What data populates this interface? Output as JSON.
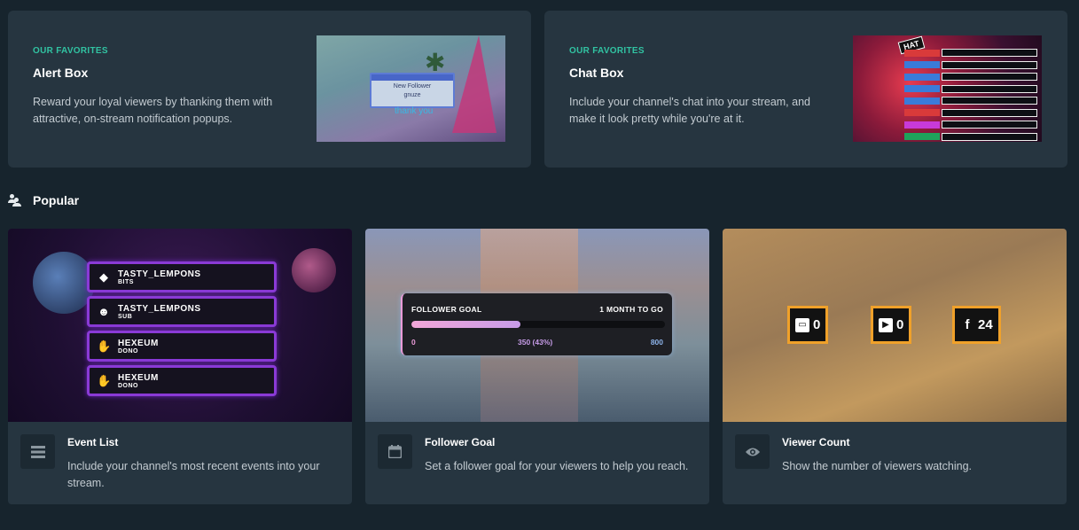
{
  "favorites": [
    {
      "eyebrow": "OUR FAVORITES",
      "title": "Alert Box",
      "description": "Reward your loyal viewers by thanking them with attractive, on-stream notification popups.",
      "preview": {
        "window_title": "New Follower",
        "window_text": "gnuze",
        "thanks_text": "thank you"
      }
    },
    {
      "eyebrow": "OUR FAVORITES",
      "title": "Chat Box",
      "description": "Include your channel's chat into your stream, and make it look pretty while you're at it.",
      "preview": {
        "logo_text": "HAT",
        "tag_colors": [
          "#d93a3a",
          "#3a7bd9",
          "#3a7bd9",
          "#3a7bd9",
          "#3a7bd9",
          "#d93a3a",
          "#c83ad9",
          "#1fa35b",
          "#1fa35b",
          "#d9a23a"
        ]
      }
    }
  ],
  "popular": {
    "heading": "Popular",
    "cards": [
      {
        "title": "Event List",
        "description": "Include your channel's most recent events into your stream.",
        "icon": "list-icon",
        "preview": {
          "items": [
            {
              "name": "TASTY_LEMPONS",
              "type": "BITS",
              "glyph": "◆"
            },
            {
              "name": "TASTY_LEMPONS",
              "type": "SUB",
              "glyph": "☻"
            },
            {
              "name": "HEXEUM",
              "type": "DONO",
              "glyph": "✋"
            },
            {
              "name": "HEXEUM",
              "type": "DONO",
              "glyph": "✋"
            }
          ]
        }
      },
      {
        "title": "Follower Goal",
        "description": "Set a follower goal for your viewers to help you reach.",
        "icon": "calendar-icon",
        "preview": {
          "label": "FOLLOWER GOAL",
          "deadline": "1 MONTH TO GO",
          "start": "0",
          "current": "350 (43%)",
          "target": "800",
          "progress_fraction": 0.43
        }
      },
      {
        "title": "Viewer Count",
        "description": "Show the number of viewers watching.",
        "icon": "eye-icon",
        "preview": {
          "counts": [
            {
              "platform": "twitch-icon",
              "value": "0"
            },
            {
              "platform": "youtube-icon",
              "value": "0"
            },
            {
              "platform": "facebook-icon",
              "value": "24"
            }
          ]
        }
      }
    ]
  },
  "colors": {
    "background": "#17242d",
    "card": "#263540",
    "accent": "#31c3a2",
    "muted_text": "#c3cbd1"
  }
}
